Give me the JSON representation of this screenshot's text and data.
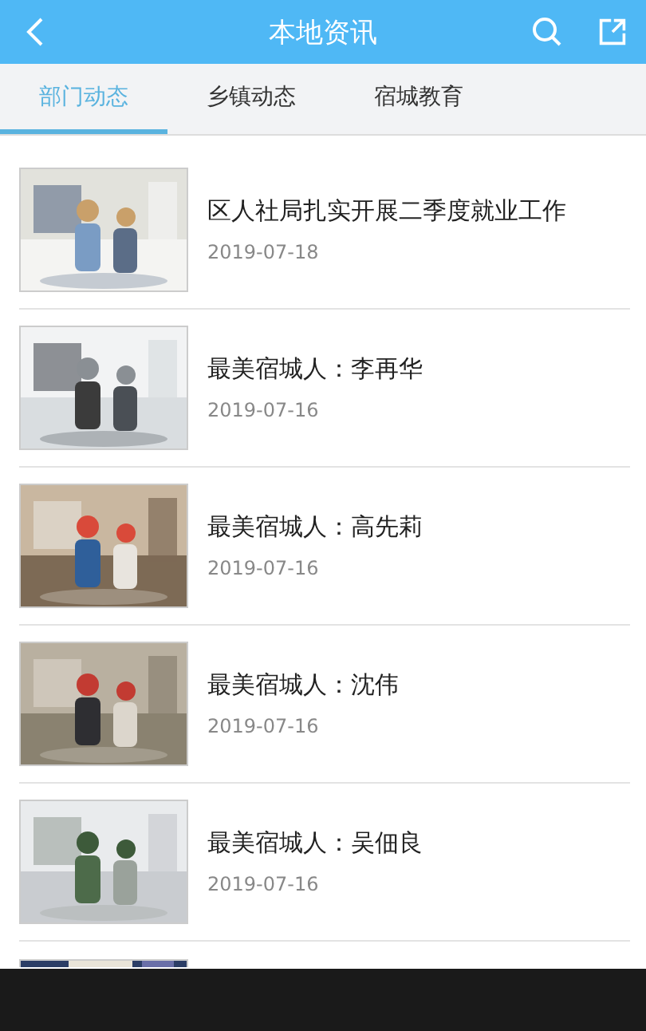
{
  "header": {
    "title": "本地资讯"
  },
  "tabs": [
    {
      "label": "部门动态",
      "selected": true
    },
    {
      "label": "乡镇动态",
      "selected": false
    },
    {
      "label": "宿城教育",
      "selected": false
    }
  ],
  "news": [
    {
      "title": "区人社局扎实开展二季度就业工作",
      "date": "2019-07-18"
    },
    {
      "title": "最美宿城人：李再华",
      "date": "2019-07-16"
    },
    {
      "title": "最美宿城人：高先莉",
      "date": "2019-07-16"
    },
    {
      "title": "最美宿城人：沈伟",
      "date": "2019-07-16"
    },
    {
      "title": "最美宿城人：吴佃良",
      "date": "2019-07-16"
    }
  ]
}
